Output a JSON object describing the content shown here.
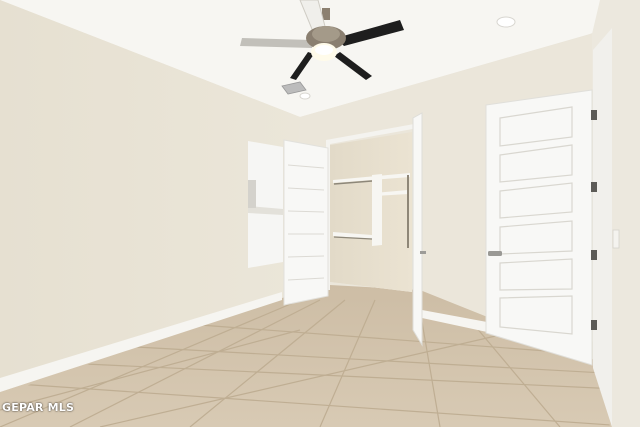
{
  "watermark": {
    "text": "GEPAR MLS"
  },
  "colors": {
    "ceiling": "#f7f6f2",
    "wall_left": "#e8e3d5",
    "wall_back": "#ebe6da",
    "wall_right": "#ece8de",
    "door_white": "#f8f8f6",
    "trim": "#f5f5f2",
    "floor_tile": "#d4c4ad",
    "grout": "#b9a98f",
    "fan_blade": "#1f1f1f",
    "fan_metal": "#9a8e7c"
  },
  "icons": [
    "ceiling-fan-icon",
    "recessed-light-icon",
    "air-vent-icon",
    "door-handle-icon",
    "door-hinge-icon"
  ]
}
